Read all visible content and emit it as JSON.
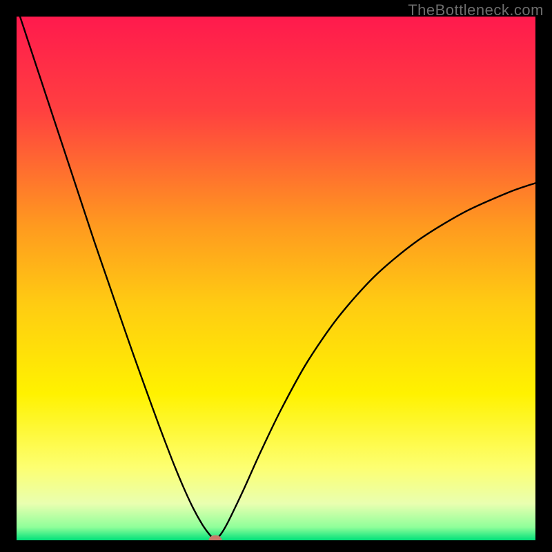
{
  "watermark": "TheBottleneck.com",
  "colors": {
    "frame_bg": "#000000",
    "curve": "#000000",
    "marker_fill": "#c77a6a",
    "marker_stroke": "#c77a6a",
    "gradient_stops": [
      {
        "offset": 0.0,
        "color": "#ff1a4d"
      },
      {
        "offset": 0.18,
        "color": "#ff4040"
      },
      {
        "offset": 0.4,
        "color": "#ff9a1f"
      },
      {
        "offset": 0.55,
        "color": "#ffcc12"
      },
      {
        "offset": 0.72,
        "color": "#fff200"
      },
      {
        "offset": 0.86,
        "color": "#fdff70"
      },
      {
        "offset": 0.93,
        "color": "#e9ffb0"
      },
      {
        "offset": 0.975,
        "color": "#8fff9a"
      },
      {
        "offset": 1.0,
        "color": "#00e07a"
      }
    ]
  },
  "chart_data": {
    "type": "line",
    "title": "",
    "xlabel": "",
    "ylabel": "",
    "xlim": [
      0,
      1
    ],
    "ylim": [
      0,
      1
    ],
    "series": [
      {
        "name": "bottleneck-curve",
        "x": [
          0.0,
          0.025,
          0.05,
          0.075,
          0.1,
          0.125,
          0.15,
          0.175,
          0.2,
          0.225,
          0.25,
          0.275,
          0.3,
          0.32,
          0.34,
          0.358,
          0.371,
          0.379,
          0.386,
          0.394,
          0.405,
          0.42,
          0.44,
          0.47,
          0.51,
          0.56,
          0.62,
          0.69,
          0.77,
          0.86,
          0.95,
          1.0
        ],
        "y": [
          1.02,
          0.945,
          0.87,
          0.795,
          0.72,
          0.645,
          0.57,
          0.498,
          0.426,
          0.355,
          0.286,
          0.218,
          0.153,
          0.105,
          0.062,
          0.03,
          0.012,
          0.004,
          0.004,
          0.012,
          0.03,
          0.06,
          0.102,
          0.168,
          0.25,
          0.34,
          0.426,
          0.504,
          0.57,
          0.625,
          0.665,
          0.682
        ]
      }
    ],
    "marker": {
      "x": 0.383,
      "y": 0.0,
      "rx": 0.012,
      "ry": 0.009
    }
  }
}
